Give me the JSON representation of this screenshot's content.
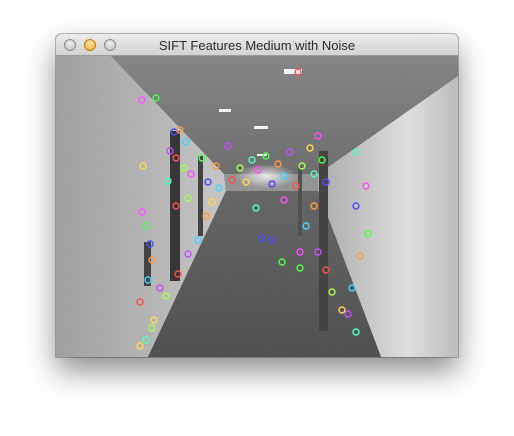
{
  "window": {
    "title": "SIFT Features Medium with Noise",
    "buttons": {
      "close": "close-button",
      "minimize": "minimize-button",
      "zoom": "zoom-button"
    }
  },
  "image": {
    "description_icon": "corridor-photo",
    "keypoint_colors": [
      "#ff4dff",
      "#4dff4d",
      "#4d4dff",
      "#ff9a3d",
      "#3dd6ff",
      "#c24dff",
      "#ff4d4d",
      "#a6ff4d",
      "#ffd84d",
      "#4dffc2"
    ]
  }
}
